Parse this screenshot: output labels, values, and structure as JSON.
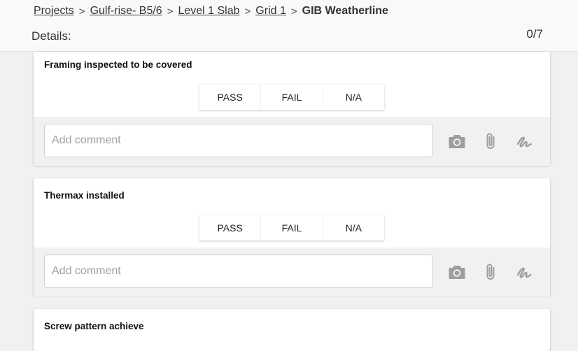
{
  "breadcrumb": {
    "items": [
      "Projects",
      "Gulf-rise- B5/6",
      "Level 1 Slab",
      "Grid 1"
    ],
    "separator": ">",
    "current": "GIB Weatherline"
  },
  "details": {
    "label": "Details:",
    "progress": "0/7"
  },
  "options": {
    "pass": "PASS",
    "fail": "FAIL",
    "na": "N/A"
  },
  "comment": {
    "placeholder": "Add comment",
    "value": ""
  },
  "icons": {
    "camera": "camera-icon",
    "attach": "paperclip-icon",
    "signature": "signature-icon"
  },
  "colors": {
    "icon": "#9e9e9e",
    "panel": "#f1f1f1",
    "card": "#ffffff"
  },
  "items": [
    {
      "title": "Framing inspected to be covered"
    },
    {
      "title": "Thermax installed"
    },
    {
      "title": "Screw pattern achieve"
    }
  ]
}
